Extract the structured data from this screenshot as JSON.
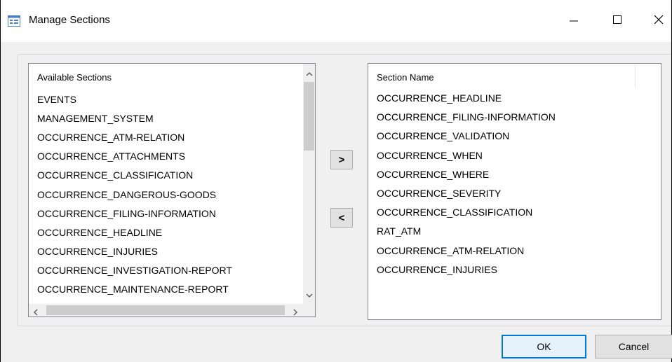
{
  "window": {
    "title": "Manage Sections",
    "icon": "list-window-icon",
    "controls": [
      "minimize-icon",
      "maximize-icon",
      "close-icon"
    ]
  },
  "available": {
    "header": "Available Sections",
    "items": [
      "EVENTS",
      "MANAGEMENT_SYSTEM",
      "OCCURRENCE_ATM-RELATION",
      "OCCURRENCE_ATTACHMENTS",
      "OCCURRENCE_CLASSIFICATION",
      "OCCURRENCE_DANGEROUS-GOODS",
      "OCCURRENCE_FILING-INFORMATION",
      "OCCURRENCE_HEADLINE",
      "OCCURRENCE_INJURIES",
      "OCCURRENCE_INVESTIGATION-REPORT",
      "OCCURRENCE_MAINTENANCE-REPORT"
    ]
  },
  "selected": {
    "header": "Section Name",
    "items": [
      "OCCURRENCE_HEADLINE",
      "OCCURRENCE_FILING-INFORMATION",
      "OCCURRENCE_VALIDATION",
      "OCCURRENCE_WHEN",
      "OCCURRENCE_WHERE",
      "OCCURRENCE_SEVERITY",
      "OCCURRENCE_CLASSIFICATION",
      "RAT_ATM",
      "OCCURRENCE_ATM-RELATION",
      "OCCURRENCE_INJURIES"
    ]
  },
  "buttons": {
    "add": ">",
    "remove": "<",
    "ok": "OK",
    "cancel": "Cancel"
  },
  "colors": {
    "ok_border": "#0078d7",
    "ok_bg": "#e5f1fb",
    "button_bg": "#e1e1e1",
    "scroll_thumb": "#cdcdcd"
  }
}
